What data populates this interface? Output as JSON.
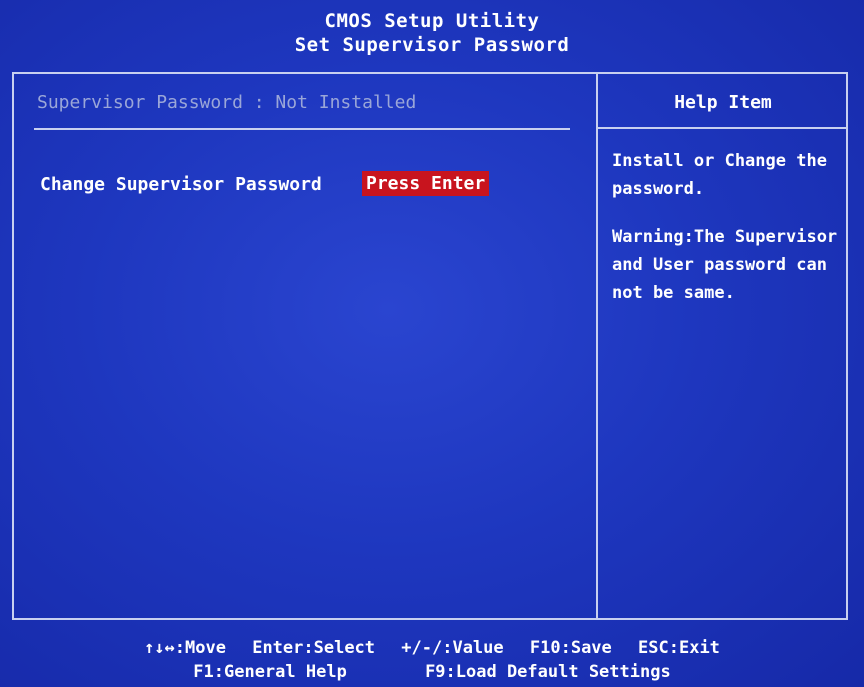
{
  "header": {
    "title": "CMOS Setup Utility",
    "subtitle": "Set Supervisor Password"
  },
  "main": {
    "status": "Supervisor Password : Not Installed",
    "item_label": "Change Supervisor Password",
    "item_value": "Press Enter"
  },
  "help": {
    "title": "Help Item",
    "text1": "Install or Change the password.",
    "text2": "Warning:The Supervisor and User password can not be same."
  },
  "footer": {
    "move": "↑↓↔:Move",
    "select": "Enter:Select",
    "value": "+/-/:Value",
    "save": "F10:Save",
    "exit": "ESC:Exit",
    "general_help": "F1:General Help",
    "load_default": "F9:Load Default Settings"
  },
  "colors": {
    "background": "#1b33b8",
    "highlight": "#c8141e",
    "dim_text": "#9aa6d8"
  }
}
